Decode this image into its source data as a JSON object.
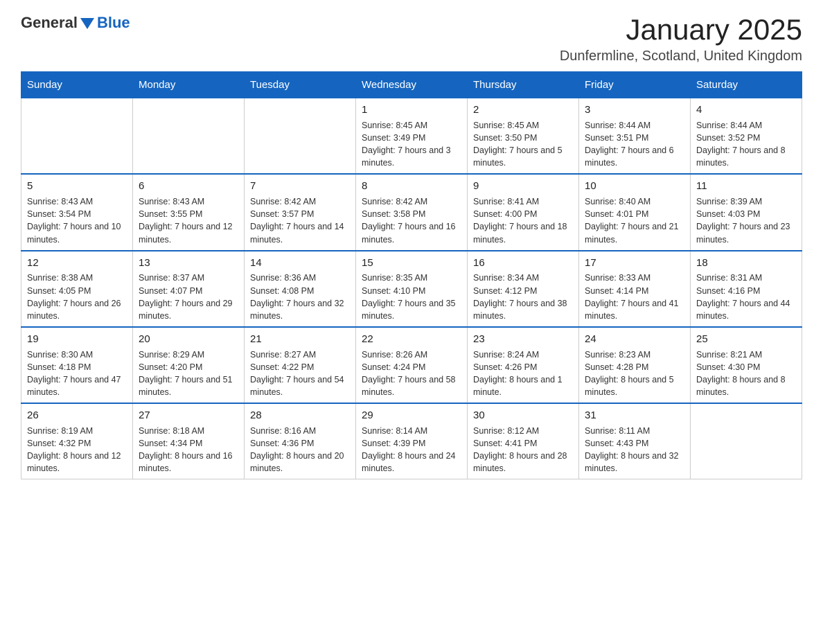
{
  "header": {
    "logo_general": "General",
    "logo_blue": "Blue",
    "title": "January 2025",
    "subtitle": "Dunfermline, Scotland, United Kingdom"
  },
  "days_of_week": [
    "Sunday",
    "Monday",
    "Tuesday",
    "Wednesday",
    "Thursday",
    "Friday",
    "Saturday"
  ],
  "weeks": [
    [
      {
        "num": "",
        "info": ""
      },
      {
        "num": "",
        "info": ""
      },
      {
        "num": "",
        "info": ""
      },
      {
        "num": "1",
        "info": "Sunrise: 8:45 AM\nSunset: 3:49 PM\nDaylight: 7 hours and 3 minutes."
      },
      {
        "num": "2",
        "info": "Sunrise: 8:45 AM\nSunset: 3:50 PM\nDaylight: 7 hours and 5 minutes."
      },
      {
        "num": "3",
        "info": "Sunrise: 8:44 AM\nSunset: 3:51 PM\nDaylight: 7 hours and 6 minutes."
      },
      {
        "num": "4",
        "info": "Sunrise: 8:44 AM\nSunset: 3:52 PM\nDaylight: 7 hours and 8 minutes."
      }
    ],
    [
      {
        "num": "5",
        "info": "Sunrise: 8:43 AM\nSunset: 3:54 PM\nDaylight: 7 hours and 10 minutes."
      },
      {
        "num": "6",
        "info": "Sunrise: 8:43 AM\nSunset: 3:55 PM\nDaylight: 7 hours and 12 minutes."
      },
      {
        "num": "7",
        "info": "Sunrise: 8:42 AM\nSunset: 3:57 PM\nDaylight: 7 hours and 14 minutes."
      },
      {
        "num": "8",
        "info": "Sunrise: 8:42 AM\nSunset: 3:58 PM\nDaylight: 7 hours and 16 minutes."
      },
      {
        "num": "9",
        "info": "Sunrise: 8:41 AM\nSunset: 4:00 PM\nDaylight: 7 hours and 18 minutes."
      },
      {
        "num": "10",
        "info": "Sunrise: 8:40 AM\nSunset: 4:01 PM\nDaylight: 7 hours and 21 minutes."
      },
      {
        "num": "11",
        "info": "Sunrise: 8:39 AM\nSunset: 4:03 PM\nDaylight: 7 hours and 23 minutes."
      }
    ],
    [
      {
        "num": "12",
        "info": "Sunrise: 8:38 AM\nSunset: 4:05 PM\nDaylight: 7 hours and 26 minutes."
      },
      {
        "num": "13",
        "info": "Sunrise: 8:37 AM\nSunset: 4:07 PM\nDaylight: 7 hours and 29 minutes."
      },
      {
        "num": "14",
        "info": "Sunrise: 8:36 AM\nSunset: 4:08 PM\nDaylight: 7 hours and 32 minutes."
      },
      {
        "num": "15",
        "info": "Sunrise: 8:35 AM\nSunset: 4:10 PM\nDaylight: 7 hours and 35 minutes."
      },
      {
        "num": "16",
        "info": "Sunrise: 8:34 AM\nSunset: 4:12 PM\nDaylight: 7 hours and 38 minutes."
      },
      {
        "num": "17",
        "info": "Sunrise: 8:33 AM\nSunset: 4:14 PM\nDaylight: 7 hours and 41 minutes."
      },
      {
        "num": "18",
        "info": "Sunrise: 8:31 AM\nSunset: 4:16 PM\nDaylight: 7 hours and 44 minutes."
      }
    ],
    [
      {
        "num": "19",
        "info": "Sunrise: 8:30 AM\nSunset: 4:18 PM\nDaylight: 7 hours and 47 minutes."
      },
      {
        "num": "20",
        "info": "Sunrise: 8:29 AM\nSunset: 4:20 PM\nDaylight: 7 hours and 51 minutes."
      },
      {
        "num": "21",
        "info": "Sunrise: 8:27 AM\nSunset: 4:22 PM\nDaylight: 7 hours and 54 minutes."
      },
      {
        "num": "22",
        "info": "Sunrise: 8:26 AM\nSunset: 4:24 PM\nDaylight: 7 hours and 58 minutes."
      },
      {
        "num": "23",
        "info": "Sunrise: 8:24 AM\nSunset: 4:26 PM\nDaylight: 8 hours and 1 minute."
      },
      {
        "num": "24",
        "info": "Sunrise: 8:23 AM\nSunset: 4:28 PM\nDaylight: 8 hours and 5 minutes."
      },
      {
        "num": "25",
        "info": "Sunrise: 8:21 AM\nSunset: 4:30 PM\nDaylight: 8 hours and 8 minutes."
      }
    ],
    [
      {
        "num": "26",
        "info": "Sunrise: 8:19 AM\nSunset: 4:32 PM\nDaylight: 8 hours and 12 minutes."
      },
      {
        "num": "27",
        "info": "Sunrise: 8:18 AM\nSunset: 4:34 PM\nDaylight: 8 hours and 16 minutes."
      },
      {
        "num": "28",
        "info": "Sunrise: 8:16 AM\nSunset: 4:36 PM\nDaylight: 8 hours and 20 minutes."
      },
      {
        "num": "29",
        "info": "Sunrise: 8:14 AM\nSunset: 4:39 PM\nDaylight: 8 hours and 24 minutes."
      },
      {
        "num": "30",
        "info": "Sunrise: 8:12 AM\nSunset: 4:41 PM\nDaylight: 8 hours and 28 minutes."
      },
      {
        "num": "31",
        "info": "Sunrise: 8:11 AM\nSunset: 4:43 PM\nDaylight: 8 hours and 32 minutes."
      },
      {
        "num": "",
        "info": ""
      }
    ]
  ]
}
